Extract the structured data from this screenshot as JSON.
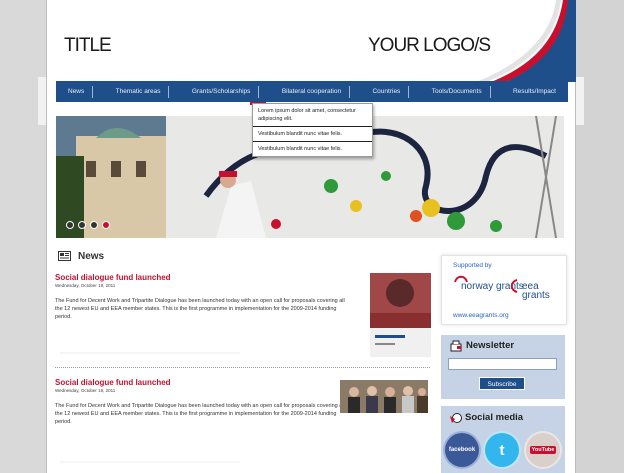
{
  "header": {
    "title": "TITLE",
    "logo_text": "YOUR LOGO/S"
  },
  "nav": {
    "items": [
      "News",
      "Thematic areas",
      "Grants/Scholarships",
      "Bilateral cooperation",
      "Countries",
      "Tools/Documents",
      "Results/Impact"
    ],
    "active": "Bilateral cooperation"
  },
  "dropdown": {
    "items": [
      "Lorem ipsum dolor sit amet, consectetur adipiscing elit.",
      "Vestibulum blandit nunc vitae felis.",
      "Vestibulum blandit nunc vitae felis."
    ]
  },
  "slider": {
    "dots": 4,
    "active_index": 3
  },
  "news": {
    "heading": "News",
    "articles": [
      {
        "title": "Social dialogue fund launched",
        "date": "Wednesday, October 19, 2011",
        "body": "The Fund for Decent Work and Tripartite Dialogue has been launched today with an open call for proposals covering all the 12 newest EU and EEA member states. This is the first programme in implementation for the 2009-2014 funding period."
      },
      {
        "title": "Social dialogue fund launched",
        "date": "Wednesday, October 19, 2011",
        "body": "The Fund for Decent Work and Tripartite Dialogue has been launched today with an open call for proposals covering all the 12 newest EU and EEA member states. This is the first programme in implementation for the 2009-2014 funding period."
      }
    ]
  },
  "supported": {
    "label": "Supported by",
    "norway_logo": "norway grants",
    "eea_logo": "eea grants",
    "link": "www.eeagrants.org"
  },
  "newsletter": {
    "title": "Newsletter",
    "input_value": "",
    "button": "Subscribe"
  },
  "social": {
    "title": "Social media",
    "facebook": "facebook",
    "youtube": "YouTube"
  },
  "colors": {
    "nav_blue": "#1f4f8a",
    "accent_red": "#c8102e",
    "link_blue": "#2a63c0",
    "panel_blue": "#c6d3e6"
  }
}
